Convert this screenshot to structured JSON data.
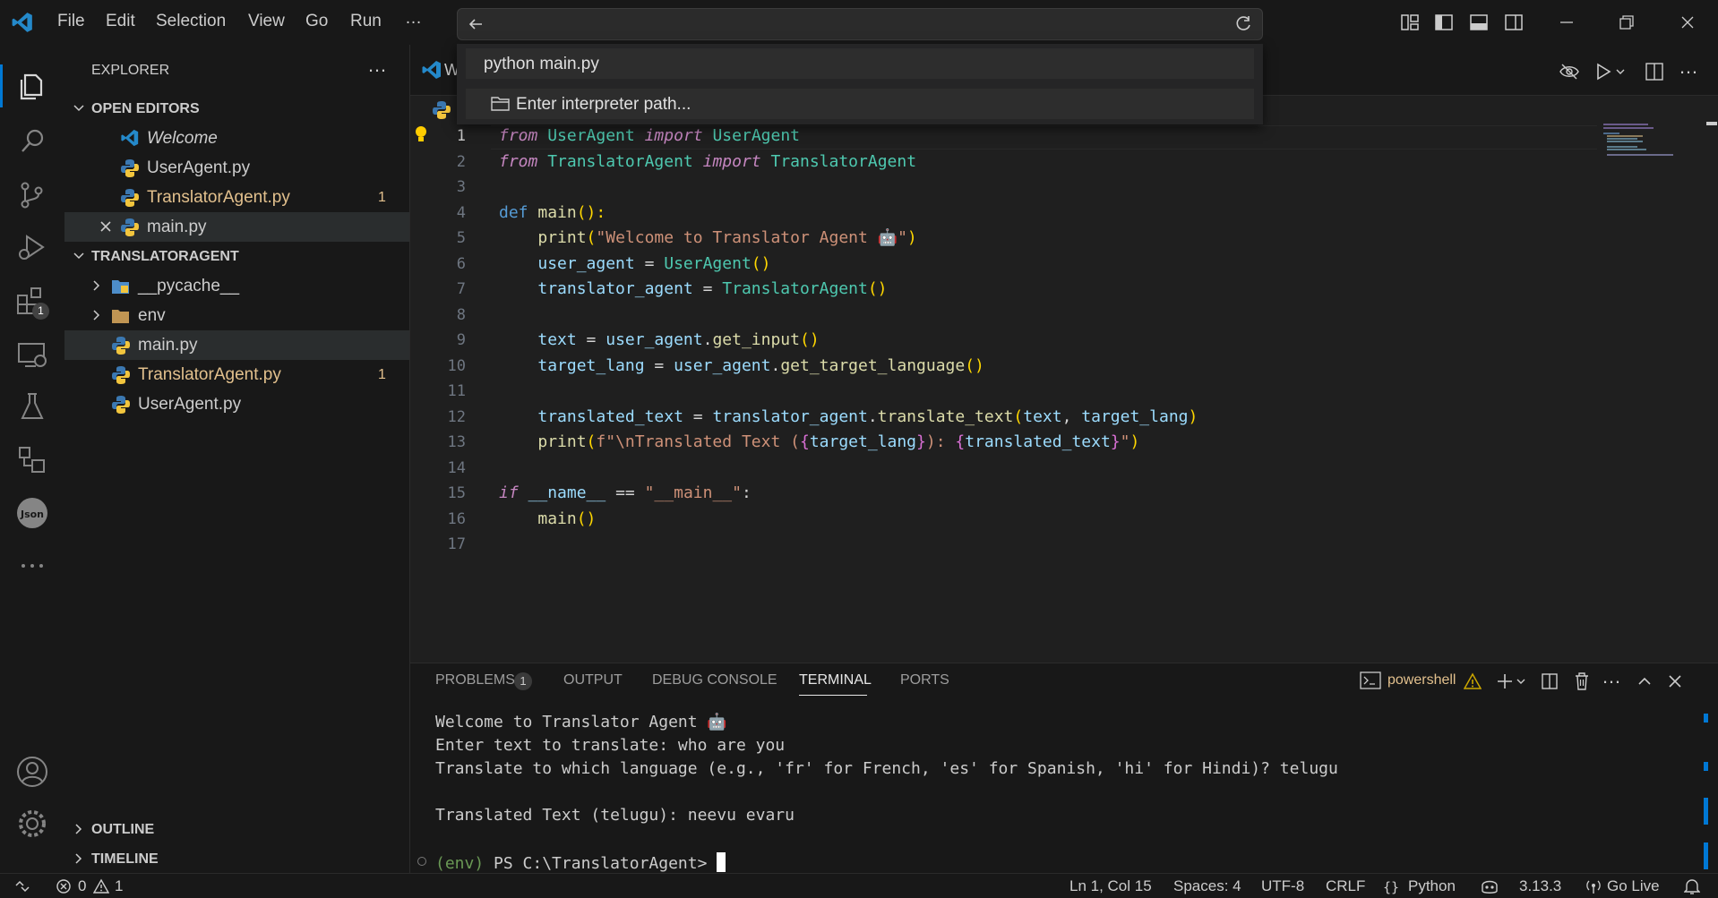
{
  "menu": [
    "File",
    "Edit",
    "Selection",
    "View",
    "Go",
    "Run",
    "…"
  ],
  "quick_pick": {
    "items": [
      {
        "label": "python main.py"
      },
      {
        "label": "Enter interpreter path..."
      }
    ]
  },
  "sidebar": {
    "title": "EXPLORER",
    "open_editors_label": "OPEN EDITORS",
    "open_editors": [
      {
        "label": "Welcome",
        "badge": ""
      },
      {
        "label": "UserAgent.py",
        "badge": ""
      },
      {
        "label": "TranslatorAgent.py",
        "badge": "1"
      },
      {
        "label": "main.py",
        "badge": ""
      }
    ],
    "folder_label": "TRANSLATORAGENT",
    "folder_items": [
      {
        "label": "__pycache__",
        "badge": ""
      },
      {
        "label": "env",
        "badge": ""
      },
      {
        "label": "main.py",
        "badge": ""
      },
      {
        "label": "TranslatorAgent.py",
        "badge": "1"
      },
      {
        "label": "UserAgent.py",
        "badge": ""
      }
    ],
    "outline_label": "OUTLINE",
    "timeline_label": "TIMELINE",
    "extensions_badge": "1"
  },
  "editor": {
    "tab_partial": "W",
    "line_numbers": [
      "1",
      "2",
      "3",
      "4",
      "5",
      "6",
      "7",
      "8",
      "9",
      "10",
      "11",
      "12",
      "13",
      "14",
      "15",
      "16",
      "17"
    ],
    "code": {
      "l1": [
        "from",
        "UserAgent",
        "import",
        "UserAgent"
      ],
      "l2": [
        "from",
        "TranslatorAgent",
        "import",
        "TranslatorAgent"
      ],
      "l4": [
        "def",
        "main",
        "():"
      ],
      "l5": [
        "print",
        "(",
        "\"Welcome to Translator Agent 🤖\"",
        ")"
      ],
      "l6": [
        "user_agent",
        " = ",
        "UserAgent",
        "()"
      ],
      "l7": [
        "translator_agent",
        " = ",
        "TranslatorAgent",
        "()"
      ],
      "l9": [
        "text",
        " = ",
        "user_agent",
        ".",
        "get_input",
        "()"
      ],
      "l10": [
        "target_lang",
        " = ",
        "user_agent",
        ".",
        "get_target_language",
        "()"
      ],
      "l12": [
        "translated_text",
        " = ",
        "translator_agent",
        ".",
        "translate_text",
        "(",
        "text",
        ", ",
        "target_lang",
        ")"
      ],
      "l13": [
        "print",
        "(",
        "f\"\\nTranslated Text (",
        "{",
        "target_lang",
        "}",
        "): ",
        "{",
        "translated_text",
        "}",
        "\"",
        ")"
      ],
      "l15": [
        "if",
        "__name__",
        " == ",
        "\"__main__\"",
        ":"
      ],
      "l16": [
        "main",
        "()"
      ]
    }
  },
  "panel": {
    "tabs": [
      "PROBLEMS",
      "OUTPUT",
      "DEBUG CONSOLE",
      "TERMINAL",
      "PORTS"
    ],
    "problems_count": "1",
    "shell_label": "powershell",
    "terminal_lines": [
      "Welcome to Translator Agent 🤖",
      "Enter text to translate: who are you",
      "Translate to which language (e.g., 'fr' for French, 'es' for Spanish, 'hi' for Hindi)? telugu",
      "",
      "Translated Text (telugu): neevu evaru"
    ],
    "prompt_env": "(env)",
    "prompt": "PS C:\\TranslatorAgent>"
  },
  "statusbar": {
    "errors": "0",
    "warnings": "1",
    "cursor": "Ln 1, Col 15",
    "spaces": "Spaces: 4",
    "encoding": "UTF-8",
    "eol": "CRLF",
    "language": "Python",
    "python_version": "3.13.3",
    "go_live": "Go Live"
  },
  "colors": {
    "accent": "#0078d4",
    "modified": "#e2c08d",
    "warning": "#cca700"
  }
}
